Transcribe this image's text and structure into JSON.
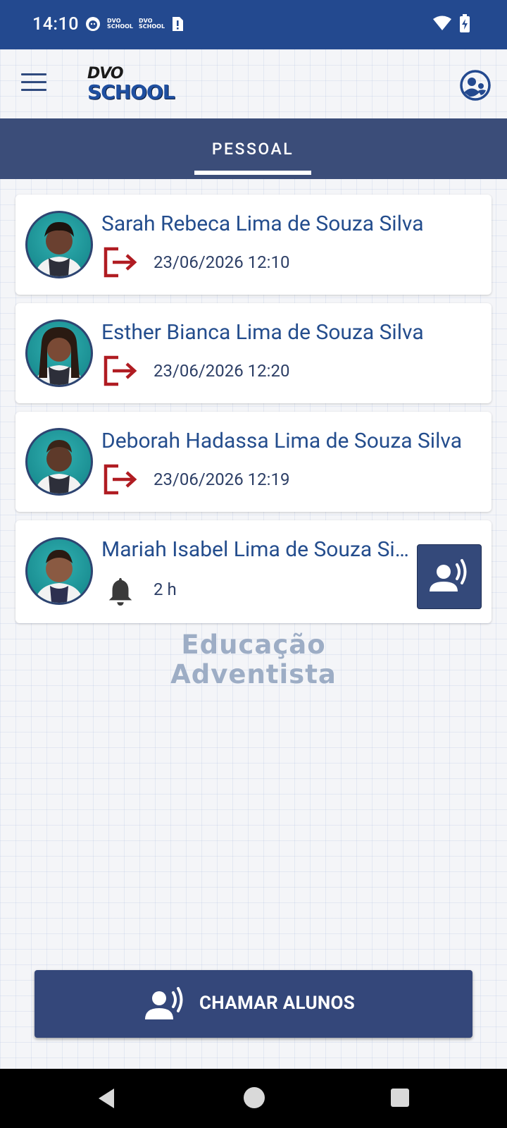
{
  "status_bar": {
    "time": "14:10",
    "mini_logo_top": "DVO",
    "mini_logo_bottom": "SCHOOL"
  },
  "app_bar": {
    "logo_top": "DVO",
    "logo_bottom": "SCHOOL"
  },
  "tabs": [
    {
      "label": "PESSOAL",
      "selected": true
    }
  ],
  "students": [
    {
      "name": "Sarah Rebeca Lima de Souza Silva",
      "event_icon": "exit-icon",
      "event_text": "23/06/2026 12:10"
    },
    {
      "name": "Esther Bianca Lima de Souza Silva",
      "event_icon": "exit-icon",
      "event_text": "23/06/2026 12:20"
    },
    {
      "name": "Deborah Hadassa Lima de Souza Silva",
      "event_icon": "exit-icon",
      "event_text": "23/06/2026 12:19"
    },
    {
      "name": "Mariah Isabel Lima de Souza Silva",
      "event_icon": "bell-icon",
      "event_text": "2 h",
      "has_call_button": true
    }
  ],
  "watermark": {
    "line1": "Educação",
    "line2": "Adventista"
  },
  "primary_action": {
    "label": "CHAMAR ALUNOS",
    "icon": "voice-call-icon"
  },
  "colors": {
    "primary": "#23498f",
    "tab_bar": "#3b4d79",
    "button": "#34477a",
    "exit_icon": "#b01c22",
    "name_text": "#244d8d"
  }
}
